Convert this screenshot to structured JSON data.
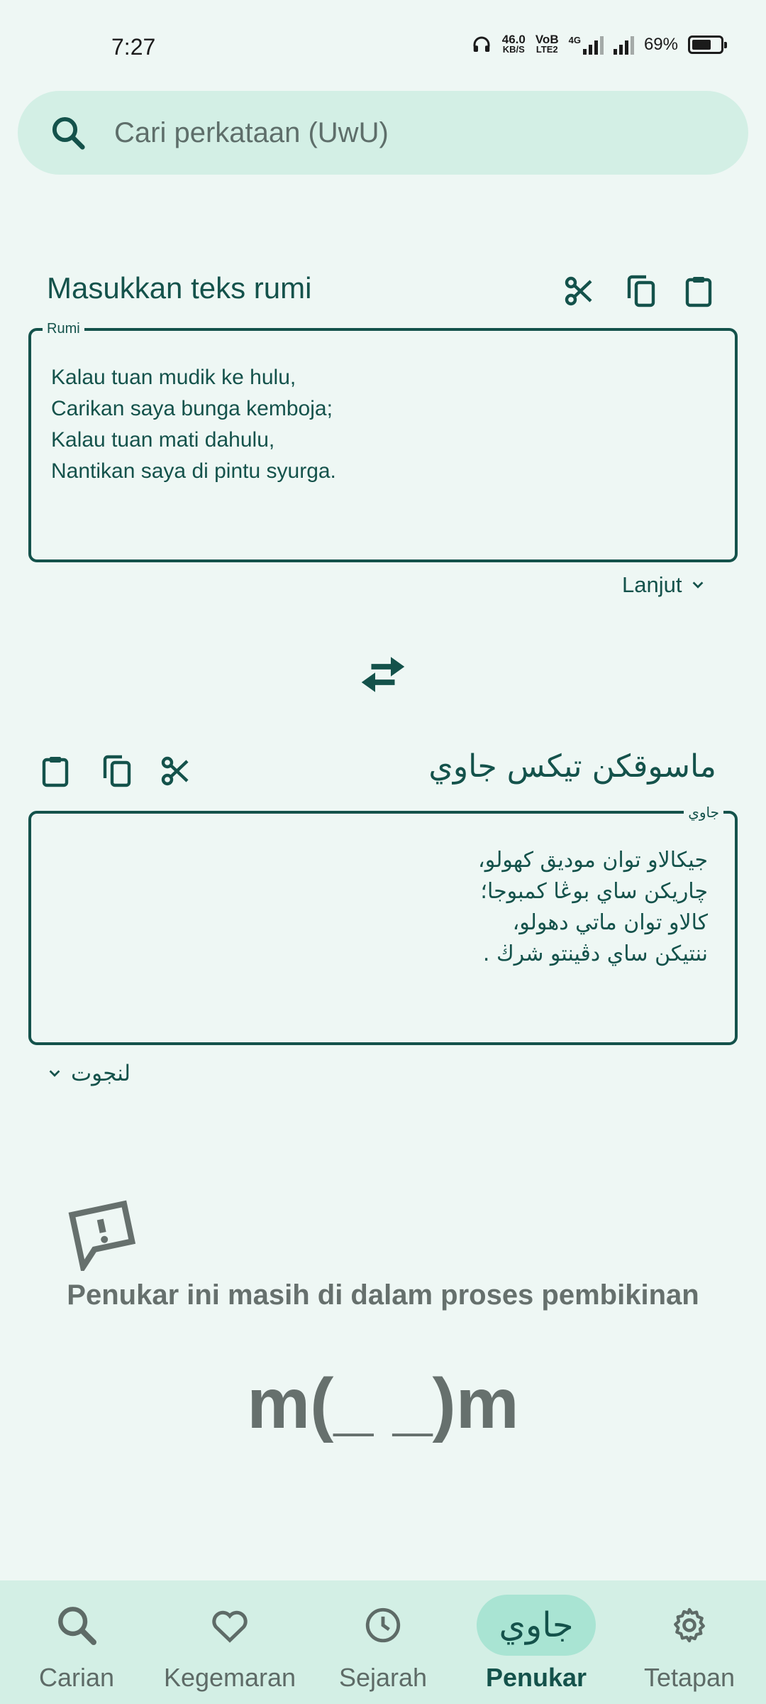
{
  "status_bar": {
    "time": "7:27",
    "net_speed": "46.0",
    "net_unit": "KB/S",
    "volte": "VoB",
    "lte": "LTE2",
    "net_type": "4G",
    "battery": "69%",
    "battery_level": 0.69
  },
  "search": {
    "placeholder": "Cari perkataan (UwU)"
  },
  "rumi_section": {
    "title": "Masukkan teks rumi",
    "field_label": "Rumi",
    "text": "Kalau tuan mudik ke hulu,\nCarikan saya bunga kemboja;\nKalau tuan mati dahulu,\nNantikan saya di pintu syurga.",
    "more_label": "Lanjut"
  },
  "jawi_section": {
    "title": "ماسوقكن تيکس جاوي",
    "field_label": "جاوي",
    "text": "جيکالاو توان موديق کهولو،\nچاريکن ساي بوڠا کمبوجا؛\nکالاو توان ماتي دهولو،\nننتيکن ساي دڤينتو شرڬ .",
    "more_label": "لنجوت"
  },
  "notice": {
    "message": "Penukar ini masih di dalam proses pembikinan",
    "emoticon": "m(_ _)m"
  },
  "bottom_nav": {
    "items": [
      {
        "label": "Carian",
        "icon": "search-icon"
      },
      {
        "label": "Kegemaran",
        "icon": "heart-icon"
      },
      {
        "label": "Sejarah",
        "icon": "clock-icon"
      },
      {
        "label": "Penukar",
        "icon": "jawi-icon",
        "icon_text": "جاوي",
        "active": true
      },
      {
        "label": "Tetapan",
        "icon": "gear-icon"
      }
    ]
  },
  "colors": {
    "background": "#eef7f4",
    "primary": "#14524b",
    "surface_tint": "#d3efe5",
    "active_pill": "#a9e4d3",
    "muted_text": "#66706d"
  }
}
